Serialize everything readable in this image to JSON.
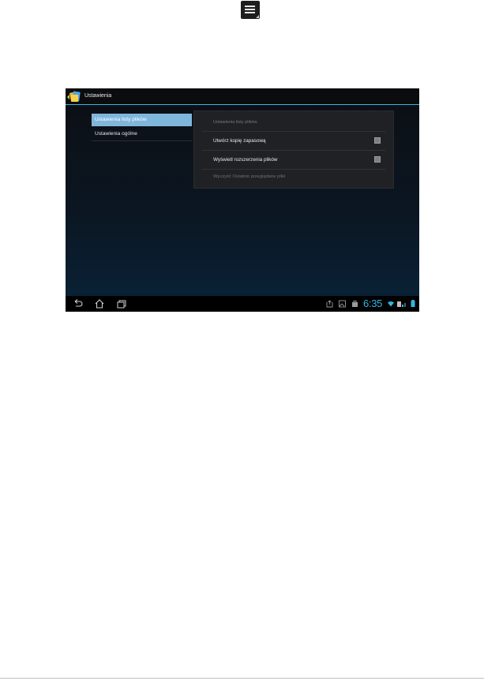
{
  "colors": {
    "accent": "#33b5e5",
    "selected_background": "#7fb6dc",
    "screen_background": "#0b1622",
    "panel_background": "#202124"
  },
  "doc_icon": {
    "icon": "overflow-menu-icon"
  },
  "app": {
    "title": "Ustawienia",
    "logo": "file-manager-app-icon"
  },
  "left_pane": {
    "items": [
      {
        "label": "Ustawienia listy plików",
        "selected": true
      },
      {
        "label": "Ustawienia ogólne",
        "selected": false
      }
    ]
  },
  "right_pane": {
    "header": "Ustawienia listy plików",
    "items": [
      {
        "label": "Utwórz kopię zapasową",
        "checkbox": true,
        "checked": false,
        "enabled": true
      },
      {
        "label": "Wyświetl rozszerzenia plików",
        "checkbox": true,
        "checked": false,
        "enabled": true
      },
      {
        "label": "Wyczyść Ostatnio przeglądane pliki",
        "checkbox": false,
        "enabled": false
      }
    ]
  },
  "system_bar": {
    "nav": [
      "back-icon",
      "home-icon",
      "recent-apps-icon"
    ],
    "status_icons": [
      "screenshot-icon",
      "gallery-icon",
      "store-icon",
      "wifi-icon",
      "signal-icon",
      "battery-icon"
    ],
    "clock": "6:35"
  }
}
